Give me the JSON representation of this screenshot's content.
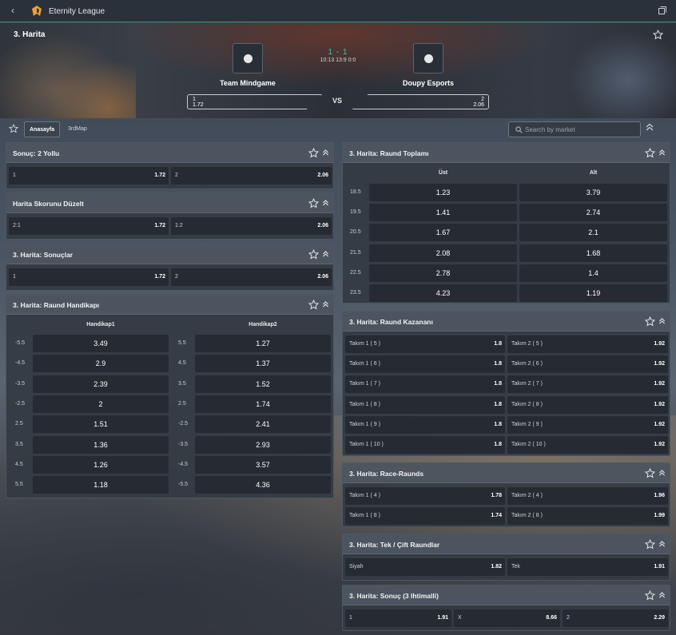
{
  "header": {
    "back": "‹",
    "league": "Eternity League"
  },
  "hero": {
    "map": "3. Harita",
    "score": "1 - 1",
    "times": "10:13  13:9  0:0",
    "team1": {
      "name": "Team Mindgame",
      "odd_label": "1",
      "odd": "1.72"
    },
    "team2": {
      "name": "Doupy Esports",
      "odd_label": "2",
      "odd": "2.06"
    },
    "vs": "VS"
  },
  "tabs": {
    "main": "Anasayfa",
    "map": "3rdMap"
  },
  "search": {
    "placeholder": "Search by market"
  },
  "m1": {
    "title": "Sonuç: 2 Yollu",
    "c": [
      {
        "l": "1",
        "v": "1.72"
      },
      {
        "l": "2",
        "v": "2.06"
      }
    ]
  },
  "m2": {
    "title": "Harita Skorunu Düzelt",
    "c": [
      {
        "l": "2:1",
        "v": "1.72"
      },
      {
        "l": "1:2",
        "v": "2.06"
      }
    ]
  },
  "m3": {
    "title": "3. Harita: Sonuçlar",
    "c": [
      {
        "l": "1",
        "v": "1.72"
      },
      {
        "l": "2",
        "v": "2.06"
      }
    ]
  },
  "m4": {
    "title": "3. Harita: Raund Handikapı",
    "h1": "Handikap1",
    "h2": "Handikap2",
    "rows": [
      {
        "a": "-5.5",
        "av": "3.49",
        "b": "5.5",
        "bv": "1.27"
      },
      {
        "a": "-4.5",
        "av": "2.9",
        "b": "4.5",
        "bv": "1.37"
      },
      {
        "a": "-3.5",
        "av": "2.39",
        "b": "3.5",
        "bv": "1.52"
      },
      {
        "a": "-2.5",
        "av": "2",
        "b": "2.5",
        "bv": "1.74"
      },
      {
        "a": "2.5",
        "av": "1.51",
        "b": "-2.5",
        "bv": "2.41"
      },
      {
        "a": "3.5",
        "av": "1.36",
        "b": "-3.5",
        "bv": "2.93"
      },
      {
        "a": "4.5",
        "av": "1.26",
        "b": "-4.5",
        "bv": "3.57"
      },
      {
        "a": "5.5",
        "av": "1.18",
        "b": "-5.5",
        "bv": "4.36"
      }
    ]
  },
  "m5": {
    "title": "3. Harita: Raund Toplamı",
    "h1": "Üst",
    "h2": "Alt",
    "rows": [
      {
        "a": "18.5",
        "av": "1.23",
        "bv": "3.79"
      },
      {
        "a": "19.5",
        "av": "1.41",
        "bv": "2.74"
      },
      {
        "a": "20.5",
        "av": "1.67",
        "bv": "2.1"
      },
      {
        "a": "21.5",
        "av": "2.08",
        "bv": "1.68"
      },
      {
        "a": "22.5",
        "av": "2.78",
        "bv": "1.4"
      },
      {
        "a": "23.5",
        "av": "4.23",
        "bv": "1.19"
      }
    ]
  },
  "m6": {
    "title": "3. Harita: Raund Kazananı",
    "rows": [
      {
        "l": "Takım 1 ( 5 )",
        "v": "1.8",
        "r": "Takım 2 ( 5 )",
        "rv": "1.92"
      },
      {
        "l": "Takım 1 ( 6 )",
        "v": "1.8",
        "r": "Takım 2 ( 6 )",
        "rv": "1.92"
      },
      {
        "l": "Takım 1 ( 7 )",
        "v": "1.8",
        "r": "Takım 2 ( 7 )",
        "rv": "1.92"
      },
      {
        "l": "Takım 1 ( 8 )",
        "v": "1.8",
        "r": "Takım 2 ( 8 )",
        "rv": "1.92"
      },
      {
        "l": "Takım 1 ( 9 )",
        "v": "1.8",
        "r": "Takım 2 ( 9 )",
        "rv": "1.92"
      },
      {
        "l": "Takım 1 ( 10 )",
        "v": "1.8",
        "r": "Takım 2 ( 10 )",
        "rv": "1.92"
      }
    ]
  },
  "m7": {
    "title": "3. Harita: Race-Raunds",
    "rows": [
      {
        "l": "Takım 1 ( 4 )",
        "v": "1.78",
        "r": "Takım 2 ( 4 )",
        "rv": "1.96"
      },
      {
        "l": "Takım 1 ( 8 )",
        "v": "1.74",
        "r": "Takım 2 ( 8 )",
        "rv": "1.99"
      }
    ]
  },
  "m8": {
    "title": "3. Harita: Tek / Çift Raundlar",
    "c": [
      {
        "l": "Siyah",
        "v": "1.82"
      },
      {
        "l": "Tek",
        "v": "1.91"
      }
    ]
  },
  "m9": {
    "title": "3. Harita: Sonuç (3 Ihtimalli)",
    "c": [
      {
        "l": "1",
        "v": "1.91"
      },
      {
        "l": "X",
        "v": "8.66"
      },
      {
        "l": "2",
        "v": "2.29"
      }
    ]
  },
  "colors": {
    "accent": "#3fc29d",
    "panel": "#343a43",
    "cell": "#262b33"
  }
}
